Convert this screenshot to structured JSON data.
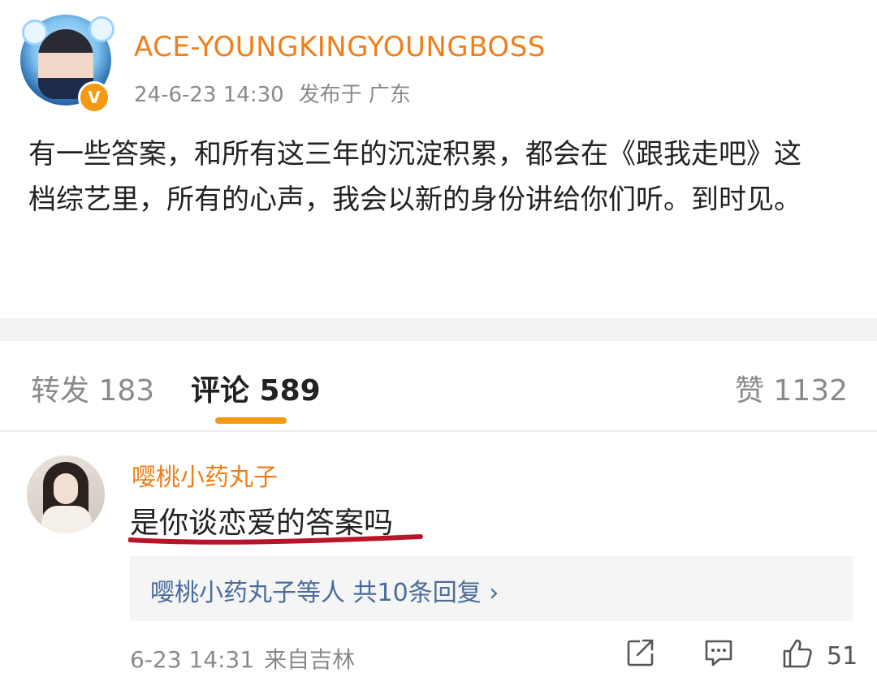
{
  "post": {
    "username": "ACE-YOUNGKINGYOUNGBOSS",
    "timestamp": "24-6-23 14:30",
    "location": "发布于 广东",
    "verified_badge": "V",
    "text": "有一些答案，和所有这三年的沉淀积累，都会在《跟我走吧》这档综艺里，所有的心声，我会以新的身份讲给你们听。到时见。"
  },
  "tabs": {
    "repost": "转发 183",
    "comments": "评论 589",
    "likes": "赞 1132"
  },
  "comment": {
    "author": "嘤桃小药丸子",
    "text": "是你谈恋爱的答案吗",
    "replies": "嘤桃小药丸子等人 共10条回复 ›",
    "timestamp": "6-23 14:31",
    "source": "来自吉林",
    "like_count": "51"
  },
  "colors": {
    "accent": "#f39a12",
    "username": "#f07e1a",
    "reply_link": "#4a6c9c",
    "annotation": "#b8152a"
  },
  "icons": {
    "share": "share-icon",
    "comment": "comment-icon",
    "like": "thumbs-up-icon"
  }
}
